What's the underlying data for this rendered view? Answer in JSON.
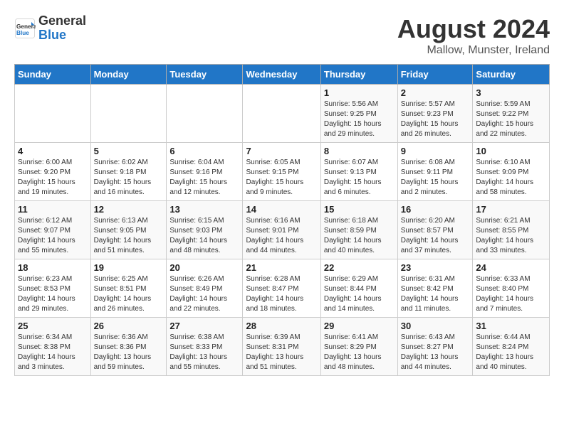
{
  "logo": {
    "line1": "General",
    "line2": "Blue"
  },
  "title": "August 2024",
  "subtitle": "Mallow, Munster, Ireland",
  "days_of_week": [
    "Sunday",
    "Monday",
    "Tuesday",
    "Wednesday",
    "Thursday",
    "Friday",
    "Saturday"
  ],
  "weeks": [
    [
      {
        "num": "",
        "info": ""
      },
      {
        "num": "",
        "info": ""
      },
      {
        "num": "",
        "info": ""
      },
      {
        "num": "",
        "info": ""
      },
      {
        "num": "1",
        "info": "Sunrise: 5:56 AM\nSunset: 9:25 PM\nDaylight: 15 hours\nand 29 minutes."
      },
      {
        "num": "2",
        "info": "Sunrise: 5:57 AM\nSunset: 9:23 PM\nDaylight: 15 hours\nand 26 minutes."
      },
      {
        "num": "3",
        "info": "Sunrise: 5:59 AM\nSunset: 9:22 PM\nDaylight: 15 hours\nand 22 minutes."
      }
    ],
    [
      {
        "num": "4",
        "info": "Sunrise: 6:00 AM\nSunset: 9:20 PM\nDaylight: 15 hours\nand 19 minutes."
      },
      {
        "num": "5",
        "info": "Sunrise: 6:02 AM\nSunset: 9:18 PM\nDaylight: 15 hours\nand 16 minutes."
      },
      {
        "num": "6",
        "info": "Sunrise: 6:04 AM\nSunset: 9:16 PM\nDaylight: 15 hours\nand 12 minutes."
      },
      {
        "num": "7",
        "info": "Sunrise: 6:05 AM\nSunset: 9:15 PM\nDaylight: 15 hours\nand 9 minutes."
      },
      {
        "num": "8",
        "info": "Sunrise: 6:07 AM\nSunset: 9:13 PM\nDaylight: 15 hours\nand 6 minutes."
      },
      {
        "num": "9",
        "info": "Sunrise: 6:08 AM\nSunset: 9:11 PM\nDaylight: 15 hours\nand 2 minutes."
      },
      {
        "num": "10",
        "info": "Sunrise: 6:10 AM\nSunset: 9:09 PM\nDaylight: 14 hours\nand 58 minutes."
      }
    ],
    [
      {
        "num": "11",
        "info": "Sunrise: 6:12 AM\nSunset: 9:07 PM\nDaylight: 14 hours\nand 55 minutes."
      },
      {
        "num": "12",
        "info": "Sunrise: 6:13 AM\nSunset: 9:05 PM\nDaylight: 14 hours\nand 51 minutes."
      },
      {
        "num": "13",
        "info": "Sunrise: 6:15 AM\nSunset: 9:03 PM\nDaylight: 14 hours\nand 48 minutes."
      },
      {
        "num": "14",
        "info": "Sunrise: 6:16 AM\nSunset: 9:01 PM\nDaylight: 14 hours\nand 44 minutes."
      },
      {
        "num": "15",
        "info": "Sunrise: 6:18 AM\nSunset: 8:59 PM\nDaylight: 14 hours\nand 40 minutes."
      },
      {
        "num": "16",
        "info": "Sunrise: 6:20 AM\nSunset: 8:57 PM\nDaylight: 14 hours\nand 37 minutes."
      },
      {
        "num": "17",
        "info": "Sunrise: 6:21 AM\nSunset: 8:55 PM\nDaylight: 14 hours\nand 33 minutes."
      }
    ],
    [
      {
        "num": "18",
        "info": "Sunrise: 6:23 AM\nSunset: 8:53 PM\nDaylight: 14 hours\nand 29 minutes."
      },
      {
        "num": "19",
        "info": "Sunrise: 6:25 AM\nSunset: 8:51 PM\nDaylight: 14 hours\nand 26 minutes."
      },
      {
        "num": "20",
        "info": "Sunrise: 6:26 AM\nSunset: 8:49 PM\nDaylight: 14 hours\nand 22 minutes."
      },
      {
        "num": "21",
        "info": "Sunrise: 6:28 AM\nSunset: 8:47 PM\nDaylight: 14 hours\nand 18 minutes."
      },
      {
        "num": "22",
        "info": "Sunrise: 6:29 AM\nSunset: 8:44 PM\nDaylight: 14 hours\nand 14 minutes."
      },
      {
        "num": "23",
        "info": "Sunrise: 6:31 AM\nSunset: 8:42 PM\nDaylight: 14 hours\nand 11 minutes."
      },
      {
        "num": "24",
        "info": "Sunrise: 6:33 AM\nSunset: 8:40 PM\nDaylight: 14 hours\nand 7 minutes."
      }
    ],
    [
      {
        "num": "25",
        "info": "Sunrise: 6:34 AM\nSunset: 8:38 PM\nDaylight: 14 hours\nand 3 minutes."
      },
      {
        "num": "26",
        "info": "Sunrise: 6:36 AM\nSunset: 8:36 PM\nDaylight: 13 hours\nand 59 minutes."
      },
      {
        "num": "27",
        "info": "Sunrise: 6:38 AM\nSunset: 8:33 PM\nDaylight: 13 hours\nand 55 minutes."
      },
      {
        "num": "28",
        "info": "Sunrise: 6:39 AM\nSunset: 8:31 PM\nDaylight: 13 hours\nand 51 minutes."
      },
      {
        "num": "29",
        "info": "Sunrise: 6:41 AM\nSunset: 8:29 PM\nDaylight: 13 hours\nand 48 minutes."
      },
      {
        "num": "30",
        "info": "Sunrise: 6:43 AM\nSunset: 8:27 PM\nDaylight: 13 hours\nand 44 minutes."
      },
      {
        "num": "31",
        "info": "Sunrise: 6:44 AM\nSunset: 8:24 PM\nDaylight: 13 hours\nand 40 minutes."
      }
    ]
  ]
}
